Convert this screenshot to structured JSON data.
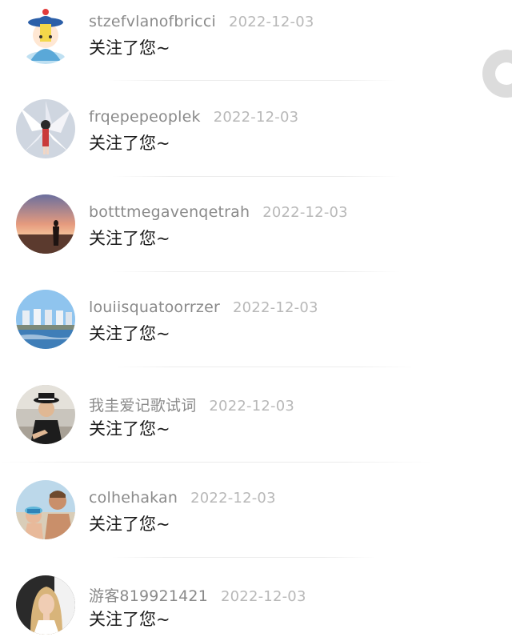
{
  "notifications": [
    {
      "username": "stzefvlanofbricci",
      "date": "2022-12-03",
      "message": "关注了您~",
      "avatar": "qing-official-cartoon-avatar"
    },
    {
      "username": "frqepepeoplek",
      "date": "2022-12-03",
      "message": "关注了您~",
      "avatar": "anime-fox-girl-avatar"
    },
    {
      "username": "botttmegavenqetrah",
      "date": "2022-12-03",
      "message": "关注了您~",
      "avatar": "sunset-silhouette-avatar"
    },
    {
      "username": "louiisquatoorrzer",
      "date": "2022-12-03",
      "message": "关注了您~",
      "avatar": "seaside-towers-avatar"
    },
    {
      "username": "我圭爱记歌试词",
      "date": "2022-12-03",
      "message": "关注了您~",
      "avatar": "man-in-hat-avatar"
    },
    {
      "username": "colhehakan",
      "date": "2022-12-03",
      "message": "关注了您~",
      "avatar": "father-and-child-beach-avatar"
    },
    {
      "username": "游客819921421",
      "date": "2022-12-03",
      "message": "关注了您~",
      "avatar": "blonde-woman-avatar"
    }
  ],
  "colors": {
    "username": "#8a8a8a",
    "date": "#b8b8b8",
    "message": "#1a1a1a",
    "divider": "#ececec",
    "background": "#ffffff"
  }
}
